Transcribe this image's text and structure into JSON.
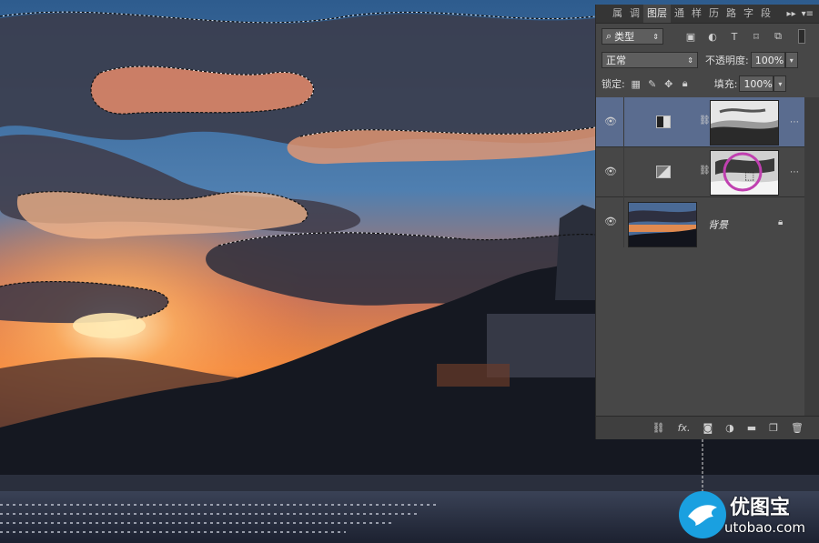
{
  "panel": {
    "tabs": [
      "属",
      "调",
      "图层",
      "通",
      "样",
      "历",
      "路",
      "字",
      "段"
    ],
    "active_tab": 2,
    "filter": {
      "kind_label": "类型"
    },
    "blend": {
      "mode": "正常",
      "opacity_label": "不透明度:",
      "opacity_value": "100%"
    },
    "lock": {
      "label": "锁定:",
      "fill_label": "填充:",
      "fill_value": "100%"
    },
    "layers": [
      {
        "name": "",
        "selected": true
      },
      {
        "name": "",
        "selected": false
      },
      {
        "name": "背景",
        "selected": false
      }
    ]
  },
  "watermark": {
    "zh": "优图宝",
    "en": "utobao.com"
  },
  "colors": {
    "panel_bg": "#474747",
    "selected_layer": "#5a6c8f",
    "highlight_circle": "#c040b0"
  }
}
